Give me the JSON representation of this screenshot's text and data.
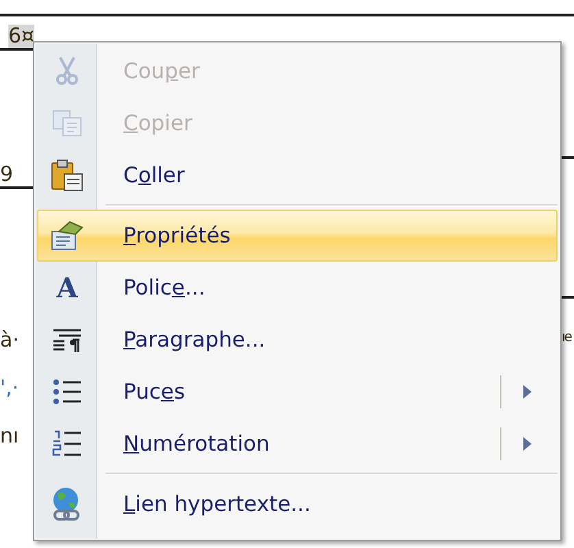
{
  "document": {
    "left_fragments": [
      {
        "text": "6¤",
        "highlighted": true,
        "color": "#3a2a10"
      },
      {
        "text": "9",
        "highlighted": false,
        "color": "#3a2a10"
      },
      {
        "text": "à·",
        "highlighted": false,
        "color": "#3a2a10"
      },
      {
        "text": "',·",
        "highlighted": false,
        "color": "#2a6fd0"
      },
      {
        "text": "nı",
        "highlighted": false,
        "color": "#3a2a10"
      }
    ],
    "right_fragments": [
      {
        "text": "ıe",
        "highlighted": false,
        "color": "#3a2a10"
      }
    ]
  },
  "context_menu": {
    "items": [
      {
        "kind": "item",
        "label": [
          {
            "t": "Cou",
            "u": false
          },
          {
            "t": "p",
            "u": true
          },
          {
            "t": "er",
            "u": false
          }
        ],
        "disabled": true,
        "selected": false,
        "submenu": false
      },
      {
        "kind": "item",
        "label": [
          {
            "t": "C",
            "u": true
          },
          {
            "t": "opier",
            "u": false
          }
        ],
        "disabled": true,
        "selected": false,
        "submenu": false
      },
      {
        "kind": "item",
        "label": [
          {
            "t": "C",
            "u": false
          },
          {
            "t": "o",
            "u": true
          },
          {
            "t": "ller",
            "u": false
          }
        ],
        "disabled": false,
        "selected": false,
        "submenu": false
      },
      {
        "kind": "separator"
      },
      {
        "kind": "item",
        "label": [
          {
            "t": "P",
            "u": true
          },
          {
            "t": "ropriétés",
            "u": false
          }
        ],
        "disabled": false,
        "selected": true,
        "submenu": false
      },
      {
        "kind": "item",
        "icon_char": "A",
        "label": [
          {
            "t": "Polic",
            "u": false
          },
          {
            "t": "e",
            "u": true
          },
          {
            "t": "...",
            "u": false
          }
        ],
        "disabled": false,
        "selected": false,
        "submenu": false
      },
      {
        "kind": "item",
        "label": [
          {
            "t": "P",
            "u": true
          },
          {
            "t": "aragraphe...",
            "u": false
          }
        ],
        "disabled": false,
        "selected": false,
        "submenu": false
      },
      {
        "kind": "item",
        "label": [
          {
            "t": "Puc",
            "u": false
          },
          {
            "t": "e",
            "u": true
          },
          {
            "t": "s",
            "u": false
          }
        ],
        "disabled": false,
        "selected": false,
        "submenu": true
      },
      {
        "kind": "item",
        "label": [
          {
            "t": "N",
            "u": true
          },
          {
            "t": "umérotation",
            "u": false
          }
        ],
        "disabled": false,
        "selected": false,
        "submenu": true
      },
      {
        "kind": "separator"
      },
      {
        "kind": "item",
        "label": [
          {
            "t": "L",
            "u": true
          },
          {
            "t": "ien hypertexte...",
            "u": false
          }
        ],
        "disabled": false,
        "selected": false,
        "submenu": false
      }
    ]
  }
}
